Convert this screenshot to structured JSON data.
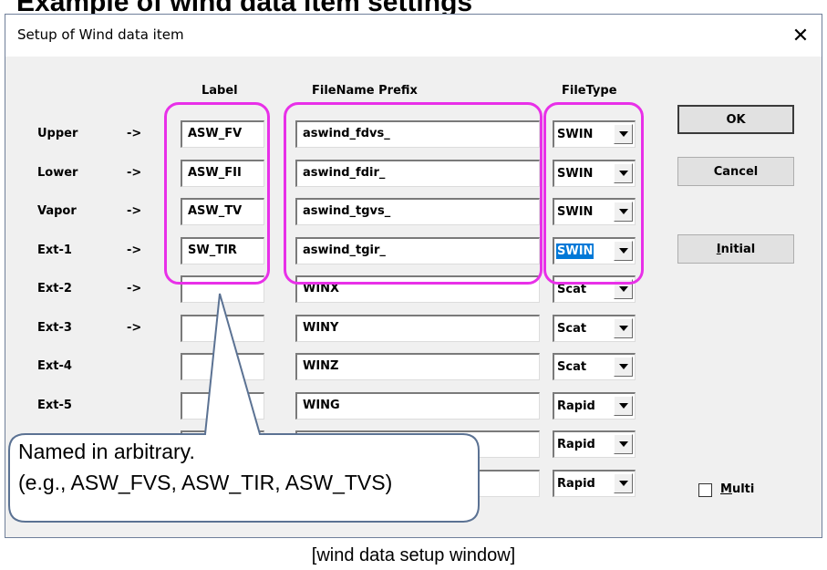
{
  "slide": {
    "title": "Example of wind data item settings",
    "caption": "[wind data setup window]"
  },
  "dialog": {
    "title": "Setup of Wind data item",
    "close_glyph": "✕",
    "headers": {
      "label": "Label",
      "prefix": "FileName Prefix",
      "filetype": "FileType"
    },
    "rows": [
      {
        "name": "Upper",
        "arrow": "->",
        "label": "ASW_FV",
        "prefix": "aswind_fdvs_",
        "filetype": "SWIN"
      },
      {
        "name": "Lower",
        "arrow": "->",
        "label": "ASW_FII",
        "prefix": "aswind_fdir_",
        "filetype": "SWIN"
      },
      {
        "name": "Vapor",
        "arrow": "->",
        "label": "ASW_TV",
        "prefix": "aswind_tgvs_",
        "filetype": "SWIN"
      },
      {
        "name": "Ext-1",
        "arrow": "->",
        "label": "SW_TIR",
        "prefix": "aswind_tgir_",
        "filetype": "SWIN"
      },
      {
        "name": "Ext-2",
        "arrow": "->",
        "label": "",
        "prefix": "WINX",
        "filetype": "Scat"
      },
      {
        "name": "Ext-3",
        "arrow": "->",
        "label": "",
        "prefix": "WINY",
        "filetype": "Scat"
      },
      {
        "name": "Ext-4",
        "arrow": "",
        "label": "",
        "prefix": "WINZ",
        "filetype": "Scat"
      },
      {
        "name": "Ext-5",
        "arrow": "",
        "label": "",
        "prefix": "WING",
        "filetype": "Rapid"
      },
      {
        "name": "",
        "arrow": "",
        "label": "",
        "prefix": "",
        "filetype": "Rapid"
      },
      {
        "name": "",
        "arrow": "",
        "label": "",
        "prefix": "",
        "filetype": "Rapid"
      }
    ],
    "buttons": {
      "ok": "OK",
      "cancel": "Cancel",
      "initial_mnemonic": "I",
      "initial_rest": "nitial"
    },
    "multi": {
      "mnemonic": "M",
      "rest": "ulti",
      "checked": false
    }
  },
  "callout": {
    "line1": "Named in arbitrary.",
    "line2": "(e.g., ASW_FVS, ASW_TIR, ASW_TVS)"
  },
  "colors": {
    "highlight": "#e830e8",
    "selection": "#0078d7",
    "window_bg": "#f0f0f0"
  }
}
